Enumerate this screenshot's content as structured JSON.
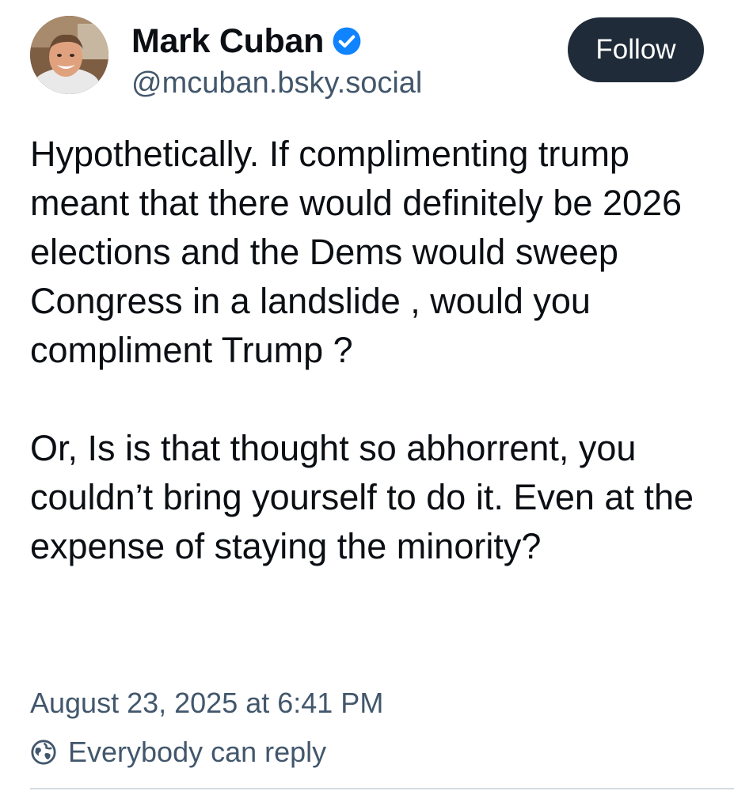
{
  "author": {
    "display_name": "Mark Cuban",
    "handle": "@mcuban.bsky.social",
    "verified_icon": "verified-check-icon",
    "avatar": "profile-photo"
  },
  "actions": {
    "follow_label": "Follow"
  },
  "post": {
    "paragraphs": [
      "Hypothetically.  If complimenting trump meant that there would definitely be 2026 elections and the Dems would sweep Congress in a landslide , would you compliment Trump ?",
      "Or, Is is that thought so abhorrent, you couldn’t bring yourself to do it.  Even at the expense of staying the minority?"
    ],
    "timestamp": "August 23, 2025 at 6:41 PM",
    "reply_setting": "Everybody can reply",
    "reply_icon": "globe-icon"
  },
  "colors": {
    "text": "#0b0f14",
    "secondary_text": "#42576c",
    "button_bg": "#1f2b38",
    "verified_blue": "#1083fe"
  }
}
